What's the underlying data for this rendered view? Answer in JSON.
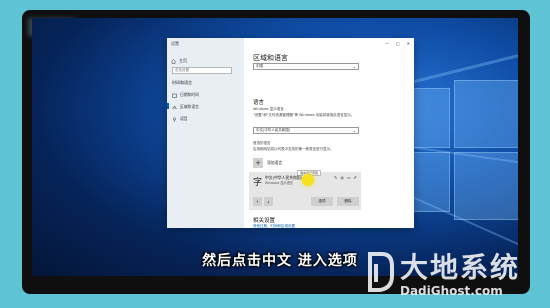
{
  "window": {
    "title": "设置",
    "controls": [
      "—",
      "□",
      "✕"
    ]
  },
  "sidebar": {
    "home_label": "主页",
    "search_placeholder": "查找设置",
    "section_title": "时间和语言",
    "items": [
      {
        "label": "日期和时间",
        "icon": "calendar-clock-icon"
      },
      {
        "label": "区域和语言",
        "icon": "language-icon"
      },
      {
        "label": "语音",
        "icon": "microphone-icon"
      }
    ]
  },
  "content": {
    "page_title": "区域和语言",
    "top_dropdown_value": "中国",
    "languages_heading": "语言",
    "display_lang_label": "Windows 显示语言",
    "display_lang_desc": "\"设置\"和\"文件资源管理器\"等 Windows 功能将使用此语言显示。",
    "display_lang_value": "中文(中华人民共和国)",
    "preferred_label": "首选的语言",
    "preferred_desc": "应用和网站将以列表中支持的第一种语言进行显示。",
    "add_language_label": "添加语言",
    "lang_item": {
      "name": "中文(中华人民共和国)",
      "sub": "Windows 显示语言",
      "tooltip": "语言包已安装",
      "options_button": "选项",
      "remove_button": "删除"
    },
    "related_heading": "相关设置",
    "related_link": "其他日期、时间和区域设置"
  },
  "caption": "然后点击中文 进入选项",
  "watermark": {
    "text_cn": "大地系统",
    "text_en": "DadiGhost.com"
  },
  "colors": {
    "accent": "#0063b1",
    "cursor_highlight": "#f7e11a",
    "background": "#5fc3d6"
  }
}
